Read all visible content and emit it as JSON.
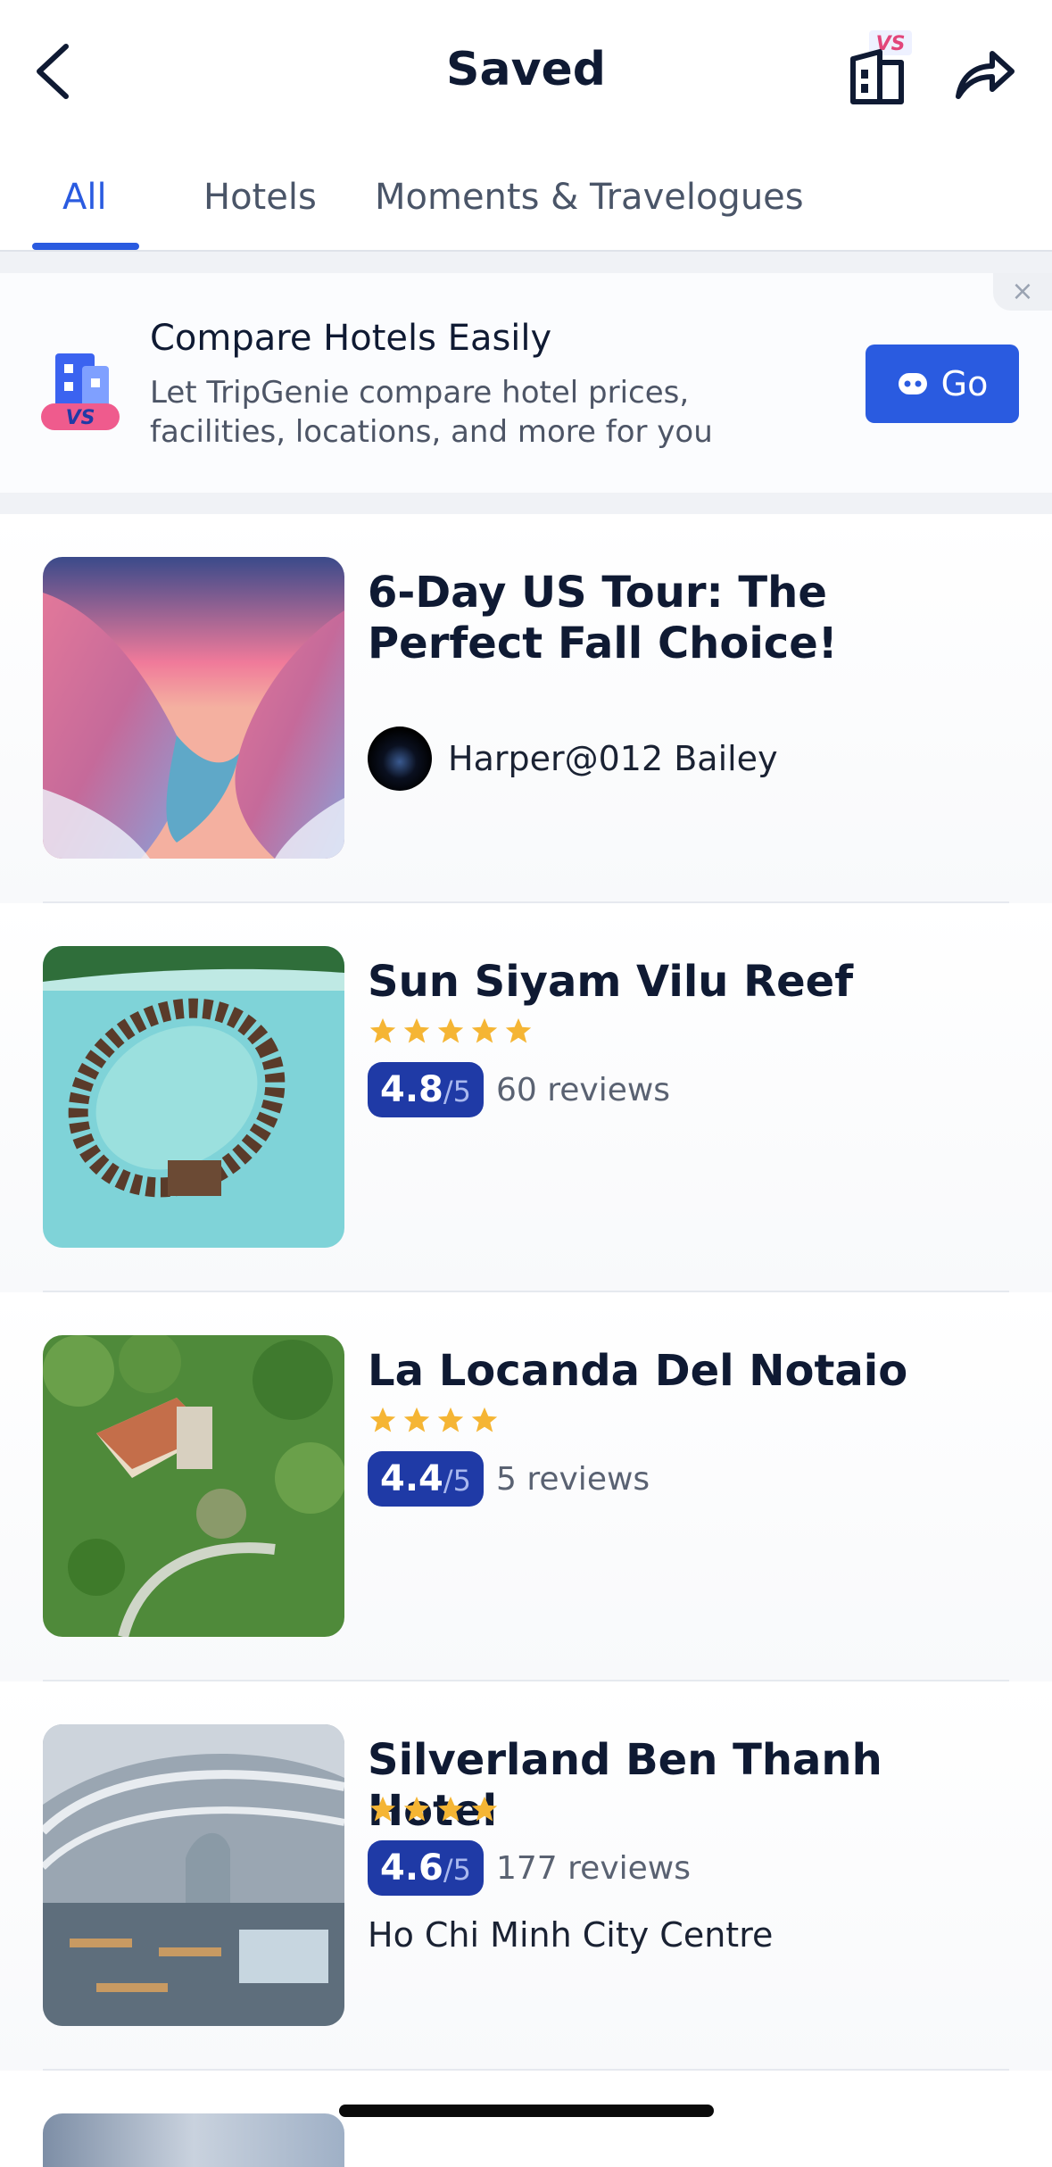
{
  "header": {
    "title": "Saved",
    "compare_badge": "VS"
  },
  "tabs": [
    {
      "label": "All",
      "active": true
    },
    {
      "label": "Hotels",
      "active": false
    },
    {
      "label": "Moments & Travelogues",
      "active": false
    }
  ],
  "banner": {
    "title": "Compare Hotels Easily",
    "subtitle": "Let TripGenie compare hotel prices, facilities, locations, and more for you",
    "button_label": "Go",
    "icon_badge": "VS",
    "close_glyph": "×"
  },
  "items": [
    {
      "type": "travelogue",
      "title": "6-Day US Tour: The Perfect Fall Choice!",
      "author": "Harper@012 Bailey"
    },
    {
      "type": "hotel",
      "name": "Sun Siyam Vilu Reef",
      "stars": 5,
      "score": "4.8",
      "score_max": "/5",
      "reviews": "60 reviews"
    },
    {
      "type": "hotel",
      "name": "La Locanda Del Notaio",
      "stars": 4,
      "score": "4.4",
      "score_max": "/5",
      "reviews": "5 reviews"
    },
    {
      "type": "hotel",
      "name": "Silverland Ben Thanh Hotel",
      "stars": 4,
      "score": "4.6",
      "score_max": "/5",
      "reviews": "177 reviews",
      "location": "Ho Chi Minh City Centre"
    }
  ],
  "colors": {
    "accent": "#2a5be0",
    "score_badge": "#1f3aa6",
    "star": "#f5b534"
  }
}
